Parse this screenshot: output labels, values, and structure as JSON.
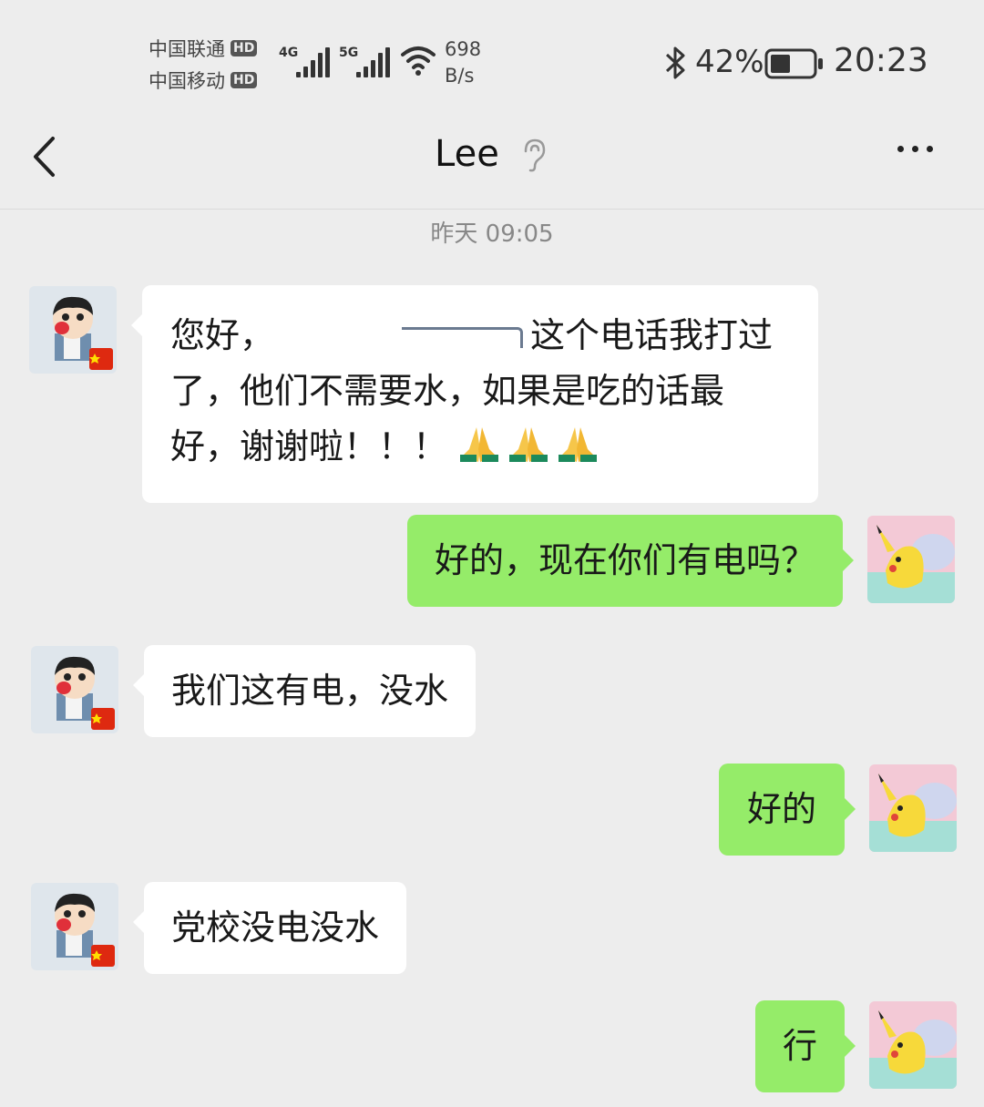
{
  "status_bar": {
    "carrier1": "中国联通",
    "carrier2": "中国移动",
    "hd_badge": "HD",
    "net1": "4G",
    "net2": "5G",
    "speed_value": "698",
    "speed_unit": "B/s",
    "battery": "42%",
    "time": "20:23",
    "icons": [
      "bluetooth-icon",
      "wifi-icon",
      "battery-icon",
      "signal-icon"
    ]
  },
  "nav": {
    "title": "Lee",
    "icons": [
      "back-icon",
      "ear-icon",
      "more-icon"
    ]
  },
  "timestamp": "昨天 09:05",
  "messages": [
    {
      "side": "left",
      "text_a": "您好，",
      "text_b": "这个电话我打过了，他们不需要水，如果是吃的话最好，谢谢啦！！！",
      "emoji": "🙏🙏🙏"
    },
    {
      "side": "right",
      "text": "好的，现在你们有电吗？"
    },
    {
      "side": "left",
      "text": "我们这有电，没水"
    },
    {
      "side": "right",
      "text": "好的"
    },
    {
      "side": "left",
      "text": "党校没电没水"
    },
    {
      "side": "right",
      "text": "行"
    }
  ],
  "colors": {
    "background": "#ededed",
    "bubble_self": "#95ec69",
    "bubble_other": "#ffffff",
    "timestamp": "#888888"
  }
}
